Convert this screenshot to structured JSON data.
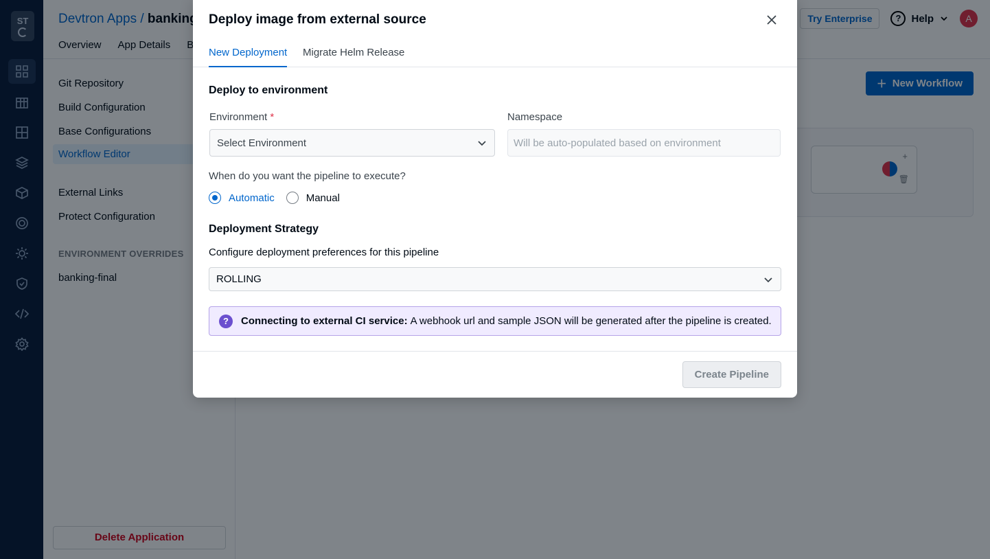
{
  "rail": {
    "logo_text": "ST"
  },
  "header": {
    "breadcrumb_root": "Devtron Apps /",
    "breadcrumb_current": "banking",
    "tabs": [
      "Overview",
      "App Details",
      "Buil"
    ],
    "try_enterprise": "Try Enterprise",
    "help": "Help",
    "avatar_initial": "A"
  },
  "sidenav": {
    "items": [
      "Git Repository",
      "Build Configuration",
      "Base Configurations",
      "Workflow Editor",
      "External Links",
      "Protect Configuration"
    ],
    "active": "Workflow Editor",
    "section_label": "ENVIRONMENT OVERRIDES",
    "env_items": [
      "banking-final"
    ],
    "delete_label": "Delete Application"
  },
  "main": {
    "new_workflow": "New Workflow",
    "add_symbol": "+",
    "delete_symbol": "🗑"
  },
  "modal": {
    "title": "Deploy image from external source",
    "tabs": [
      {
        "label": "New Deployment",
        "active": true
      },
      {
        "label": "Migrate Helm Release",
        "active": false
      }
    ],
    "deploy_section": "Deploy to environment",
    "environment_label": "Environment",
    "required_mark": "*",
    "environment_placeholder": "Select Environment",
    "namespace_label": "Namespace",
    "namespace_placeholder": "Will be auto-populated based on environment",
    "execute_question": "When do you want the pipeline to execute?",
    "execute_options": {
      "automatic": "Automatic",
      "manual": "Manual",
      "selected": "Automatic"
    },
    "strategy_section": "Deployment Strategy",
    "strategy_description": "Configure deployment preferences for this pipeline",
    "strategy_value": "ROLLING",
    "info_bold": "Connecting to external CI service:",
    "info_text": "A webhook url and sample JSON will be generated after the pipeline is created.",
    "create_button": "Create Pipeline"
  },
  "colors": {
    "primary": "#0066cc",
    "danger": "#d0021b",
    "overlay": "rgba(0,10,20,0.5)",
    "info_bg": "#f0ebff"
  }
}
